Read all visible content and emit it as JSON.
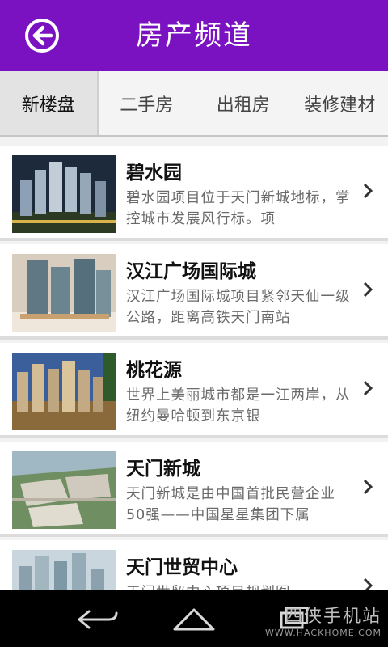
{
  "header": {
    "title": "房产频道",
    "back_icon": "back-arrow-icon"
  },
  "tabs": [
    {
      "label": "新楼盘",
      "active": true
    },
    {
      "label": "二手房",
      "active": false
    },
    {
      "label": "出租房",
      "active": false
    },
    {
      "label": "装修建材",
      "active": false
    }
  ],
  "items": [
    {
      "title": "碧水园",
      "desc": "碧水园项目位于天门新城地标，掌控城市发展风行标。项"
    },
    {
      "title": "汉江广场国际城",
      "desc": "汉江广场国际城项目紧邻天仙一级公路，距离高铁天门南站"
    },
    {
      "title": "桃花源",
      "desc": "世界上美丽城市都是一江两岸，从纽约曼哈顿到东京银"
    },
    {
      "title": "天门新城",
      "desc": "天门新城是由中国首批民营企业50强——中国星星集团下属"
    },
    {
      "title": "天门世贸中心",
      "desc": "天门世贸中心项目规划图"
    }
  ],
  "nav": {
    "back": "back-icon",
    "home": "home-icon",
    "recents": "recents-icon"
  },
  "watermark": {
    "top": "四侠手机站",
    "bottom": "WWW.HACKHOME.COM"
  },
  "colors": {
    "header": "#7b12c2",
    "navbar": "#000000"
  }
}
